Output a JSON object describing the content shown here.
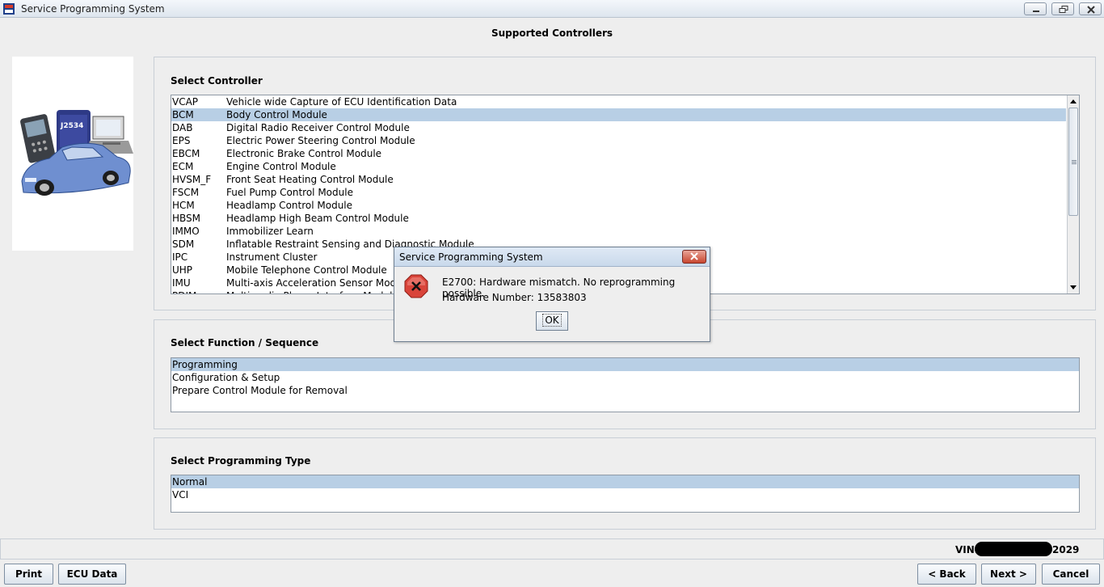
{
  "window": {
    "title": "Service Programming System"
  },
  "page": {
    "heading": "Supported Controllers"
  },
  "controller_group": {
    "title": "Select Controller",
    "items": [
      {
        "code": "VCAP",
        "name": "Vehicle wide Capture of ECU Identification Data",
        "selected": false
      },
      {
        "code": "BCM",
        "name": "Body Control Module",
        "selected": true
      },
      {
        "code": "DAB",
        "name": "Digital Radio Receiver Control Module",
        "selected": false
      },
      {
        "code": "EPS",
        "name": "Electric Power Steering Control Module",
        "selected": false
      },
      {
        "code": "EBCM",
        "name": "Electronic Brake Control Module",
        "selected": false
      },
      {
        "code": "ECM",
        "name": "Engine Control Module",
        "selected": false
      },
      {
        "code": "HVSM_F",
        "name": "Front Seat Heating Control Module",
        "selected": false
      },
      {
        "code": "FSCM",
        "name": "Fuel Pump Control Module",
        "selected": false
      },
      {
        "code": "HCM",
        "name": "Headlamp Control Module",
        "selected": false
      },
      {
        "code": "HBSM",
        "name": "Headlamp High Beam Control Module",
        "selected": false
      },
      {
        "code": "IMMO",
        "name": "Immobilizer Learn",
        "selected": false
      },
      {
        "code": "SDM",
        "name": "Inflatable Restraint Sensing and Diagnostic Module",
        "selected": false
      },
      {
        "code": "IPC",
        "name": "Instrument Cluster",
        "selected": false
      },
      {
        "code": "UHP",
        "name": "Mobile Telephone Control Module",
        "selected": false
      },
      {
        "code": "IMU",
        "name": "Multi-axis Acceleration Sensor Module",
        "selected": false
      },
      {
        "code": "PDIM",
        "name": "Multimedia Player Interface Module",
        "selected": false
      }
    ]
  },
  "function_group": {
    "title": "Select Function / Sequence",
    "items": [
      {
        "label": "Programming",
        "selected": true
      },
      {
        "label": "Configuration & Setup",
        "selected": false
      },
      {
        "label": "Prepare Control Module for Removal",
        "selected": false
      }
    ]
  },
  "programming_type_group": {
    "title": "Select Programming Type",
    "items": [
      {
        "label": "Normal",
        "selected": true
      },
      {
        "label": "VCI",
        "selected": false
      }
    ]
  },
  "status": {
    "vin_label": "VIN:",
    "vin_visible_suffix": "2029"
  },
  "buttons": {
    "print": "Print",
    "ecu_data": "ECU Data",
    "back": "< Back",
    "next": "Next >",
    "cancel": "Cancel"
  },
  "dialog": {
    "title": "Service Programming System",
    "message": "E2700: Hardware mismatch. No reprogramming possible.",
    "detail": "Hardware Number: 13583803",
    "ok_label": "OK"
  },
  "image_card": {
    "badge": "J2534"
  },
  "colors": {
    "selection": "#b8cfe5",
    "background": "#eeeeee",
    "error_icon": "#d9443a"
  }
}
